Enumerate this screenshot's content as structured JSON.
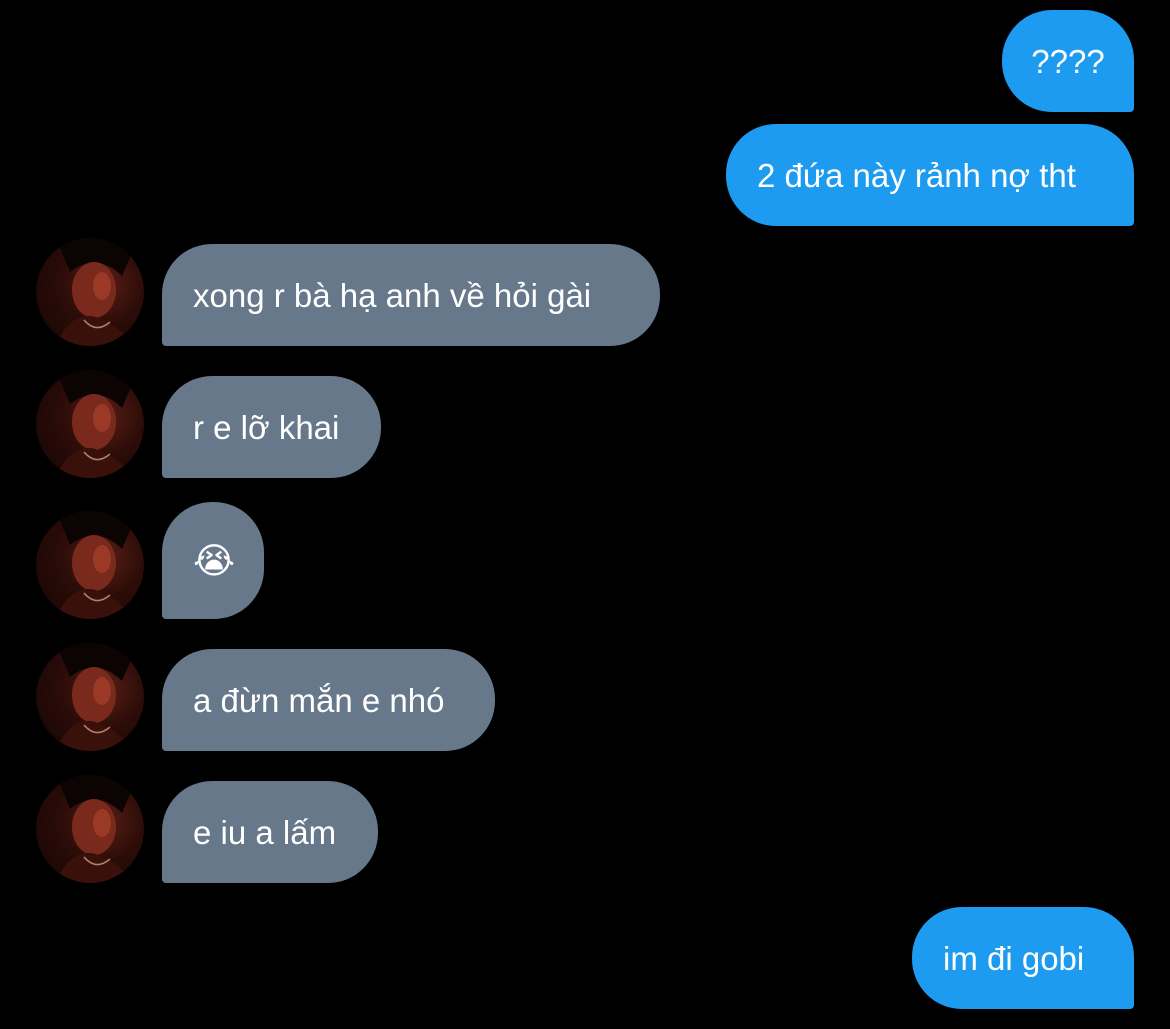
{
  "conversation": {
    "messages": [
      {
        "sender": "me",
        "text": "????"
      },
      {
        "sender": "me",
        "text": "2 đứa này rảnh nợ tht"
      },
      {
        "sender": "them",
        "text": "xong r bà hạ anh về hỏi gài"
      },
      {
        "sender": "them",
        "text": "r e lỡ khai"
      },
      {
        "sender": "them",
        "text": "😭"
      },
      {
        "sender": "them",
        "text": "a đừn mắn e nhó"
      },
      {
        "sender": "them",
        "text": "e iu a lấm"
      },
      {
        "sender": "me",
        "text": "im đi gobi"
      }
    ]
  },
  "colors": {
    "background": "#000000",
    "sent_bubble": "#1d9bf0",
    "received_bubble": "#67788a",
    "text": "#ffffff"
  },
  "icons": {
    "avatar": "contact-avatar-photo",
    "crying_emoji": "loudly-crying-face"
  }
}
